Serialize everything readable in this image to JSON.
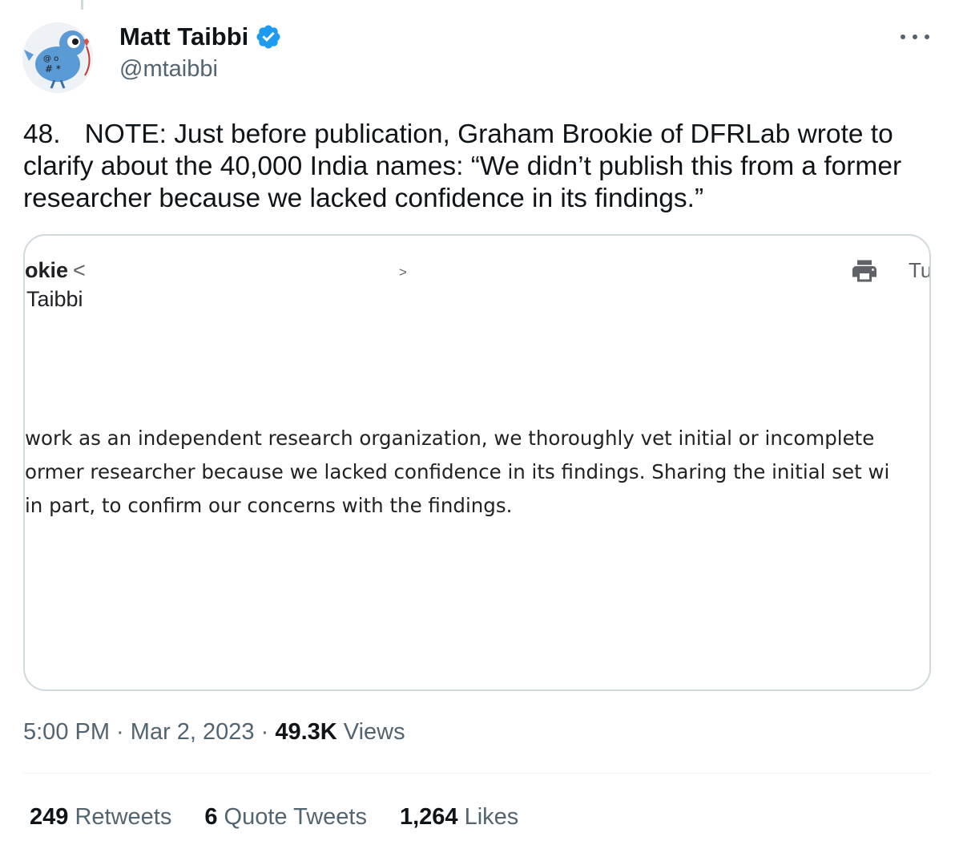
{
  "author": {
    "name": "Matt Taibbi",
    "handle": "@mtaibbi",
    "verified_color": "#1d9bf0"
  },
  "tweet": {
    "number": "48.",
    "text": "NOTE: Just before publication, Graham Brookie of DFRLab wrote to clarify about the 40,000 India names: “We didn’t publish this from a former researcher because we lacked confidence in its findings.”"
  },
  "media": {
    "sender": "okie",
    "sender_lt": "<",
    "sender_gt": ">",
    "recipient": "Taibbi",
    "date_partial": "Tu",
    "print_icon": "printer-icon",
    "body_lines": [
      " work as an independent research organization, we thoroughly vet initial or incomplete",
      "ormer researcher because we lacked confidence in its findings. Sharing the initial set wi",
      "in part, to confirm our concerns with the findings."
    ]
  },
  "meta": {
    "time": "5:00 PM",
    "separator": " · ",
    "date": "Mar 2, 2023",
    "views_count": "49.3K",
    "views_label": " Views"
  },
  "stats": {
    "retweets_count": "249",
    "retweets_label": " Retweets",
    "quotes_count": "6",
    "quotes_label": " Quote Tweets",
    "likes_count": "1,264",
    "likes_label": " Likes"
  }
}
